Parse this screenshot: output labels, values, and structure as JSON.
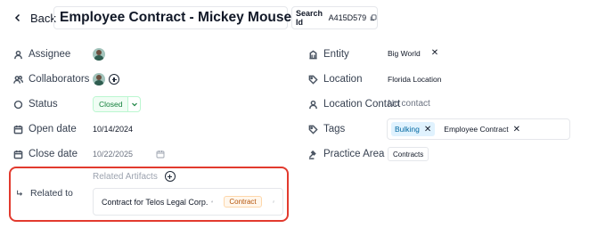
{
  "header": {
    "back_label": "Back",
    "title": "Employee Contract - Mickey Mouse",
    "search_id_label": "Search Id",
    "search_id_value": "A415D579"
  },
  "left_fields": {
    "assignee": {
      "label": "Assignee"
    },
    "collaborators": {
      "label": "Collaborators"
    },
    "status": {
      "label": "Status",
      "value": "Closed"
    },
    "open_date": {
      "label": "Open date",
      "value": "10/14/2024"
    },
    "close_date": {
      "label": "Close date",
      "placeholder": "10/22/2025"
    },
    "related_to": {
      "label": "Related to"
    }
  },
  "related": {
    "heading": "Related Artifacts",
    "artifact_title": "Contract for Telos Legal Corp.",
    "artifact_type": "Contract"
  },
  "right_fields": {
    "entity": {
      "label": "Entity",
      "value": "Big World"
    },
    "location": {
      "label": "Location",
      "value": "Florida Location"
    },
    "location_contact": {
      "label": "Location Contact",
      "value": "No contact"
    },
    "tags": {
      "label": "Tags",
      "items": [
        "Bulking",
        "Employee Contract"
      ]
    },
    "practice_area": {
      "label": "Practice Area",
      "value": "Contracts"
    }
  },
  "colors": {
    "highlight_border": "#e23a2e",
    "status_green": "#15803d",
    "tag_blue": "#0369a1",
    "badge_orange": "#b45309"
  }
}
